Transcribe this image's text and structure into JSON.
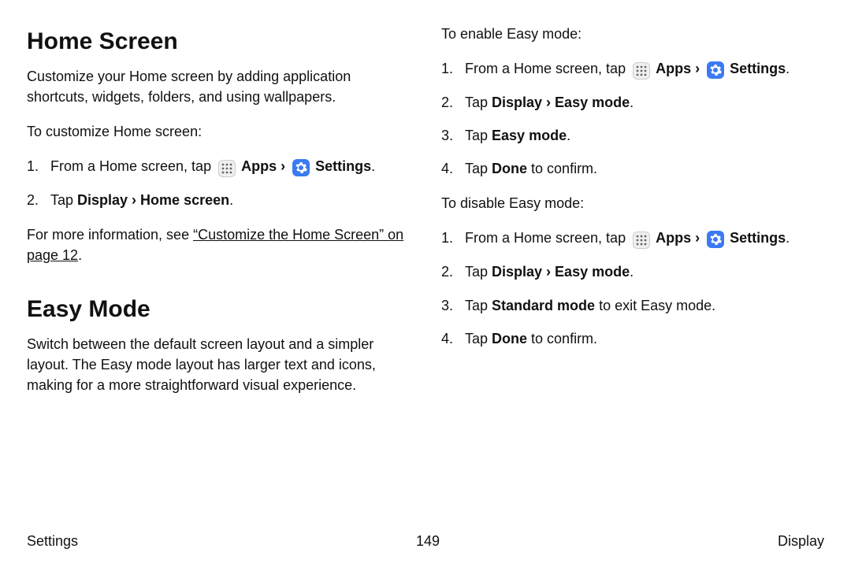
{
  "left": {
    "h1a": "Home Screen",
    "p1": "Customize your Home screen by adding application shortcuts, widgets, folders, and using wallpapers.",
    "p2": "To customize Home screen:",
    "step1_pre": "From a Home screen, tap ",
    "apps_label": "Apps",
    "chev": "›",
    "settings_label": "Settings",
    "step2_pre": "Tap ",
    "step2_bold": "Display › Home screen",
    "more_pre": "For more information, see ",
    "more_link": "“Customize the Home Screen” on page 12",
    "h1b": "Easy Mode",
    "p3": "Switch between the default screen layout and a simpler layout. The Easy mode layout has larger text and icons, making for a more straightforward visual experience."
  },
  "right": {
    "enable_intro": "To enable Easy mode:",
    "step1_pre": "From a Home screen, tap ",
    "apps_label": "Apps",
    "chev": "›",
    "settings_label": "Settings",
    "step2_pre": "Tap ",
    "step2_bold": "Display › Easy mode",
    "step3_pre": "Tap ",
    "step3_bold": "Easy mode",
    "step4_pre": "Tap ",
    "step4_bold": "Done",
    "step4_post": " to confirm.",
    "disable_intro": "To disable Easy mode:",
    "d_step3_pre": "Tap ",
    "d_step3_bold": "Standard mode",
    "d_step3_post": " to exit Easy mode."
  },
  "footer": {
    "left": "Settings",
    "center": "149",
    "right": "Display"
  }
}
